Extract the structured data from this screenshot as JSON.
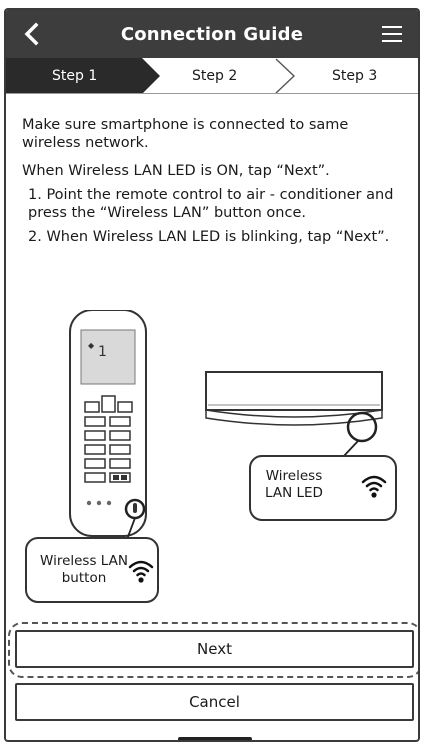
{
  "header": {
    "title": "Connection Guide",
    "back_icon": "chevron-left-icon",
    "menu_icon": "hamburger-menu-icon",
    "background_color": "#3d3d3d"
  },
  "steps": [
    {
      "label": "Step 1",
      "active": true
    },
    {
      "label": "Step 2",
      "active": false
    },
    {
      "label": "Step 3",
      "active": false
    }
  ],
  "instructions": {
    "line1": "Make sure smartphone is connected to same wireless network.",
    "line2": "When Wireless LAN LED is ON, tap “Next”.",
    "step1": "1. Point the remote control to air - conditioner and press the “Wireless LAN” button once.",
    "step2": "2. When Wireless LAN LED is blinking, tap “Next”."
  },
  "illustration": {
    "remote_display": "1",
    "remote_callout": "Wireless LAN button",
    "ac_callout": "Wireless LAN LED",
    "wifi_icon": "wifi-icon"
  },
  "buttons": {
    "next_label": "Next",
    "cancel_label": "Cancel"
  }
}
